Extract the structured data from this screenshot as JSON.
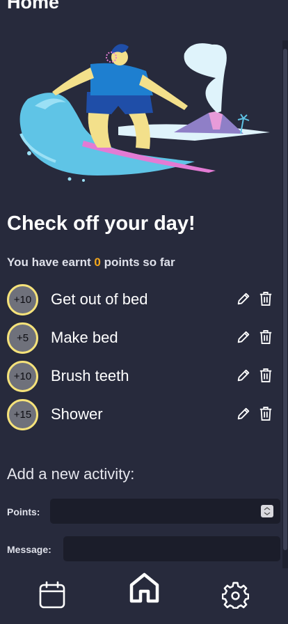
{
  "header": {
    "title": "Home"
  },
  "main": {
    "heading": "Check off your day!",
    "points_prefix": "You have earnt",
    "points_value": "0",
    "points_suffix": "points so far",
    "activities": [
      {
        "points": "+10",
        "label": "Get out of bed"
      },
      {
        "points": "+5",
        "label": "Make bed"
      },
      {
        "points": "+10",
        "label": "Brush teeth"
      },
      {
        "points": "+15",
        "label": "Shower"
      }
    ]
  },
  "form": {
    "heading": "Add a new activity:",
    "points_label": "Points:",
    "message_label": "Message:",
    "points_value": "",
    "message_value": ""
  },
  "nav": {
    "items": [
      "calendar-icon",
      "home-icon",
      "settings-icon"
    ],
    "active": "home-icon"
  },
  "colors": {
    "background": "#272a3c",
    "accent": "#f6a81c",
    "badge_border": "#f5e27a",
    "input_bg": "#1b1d2a"
  }
}
